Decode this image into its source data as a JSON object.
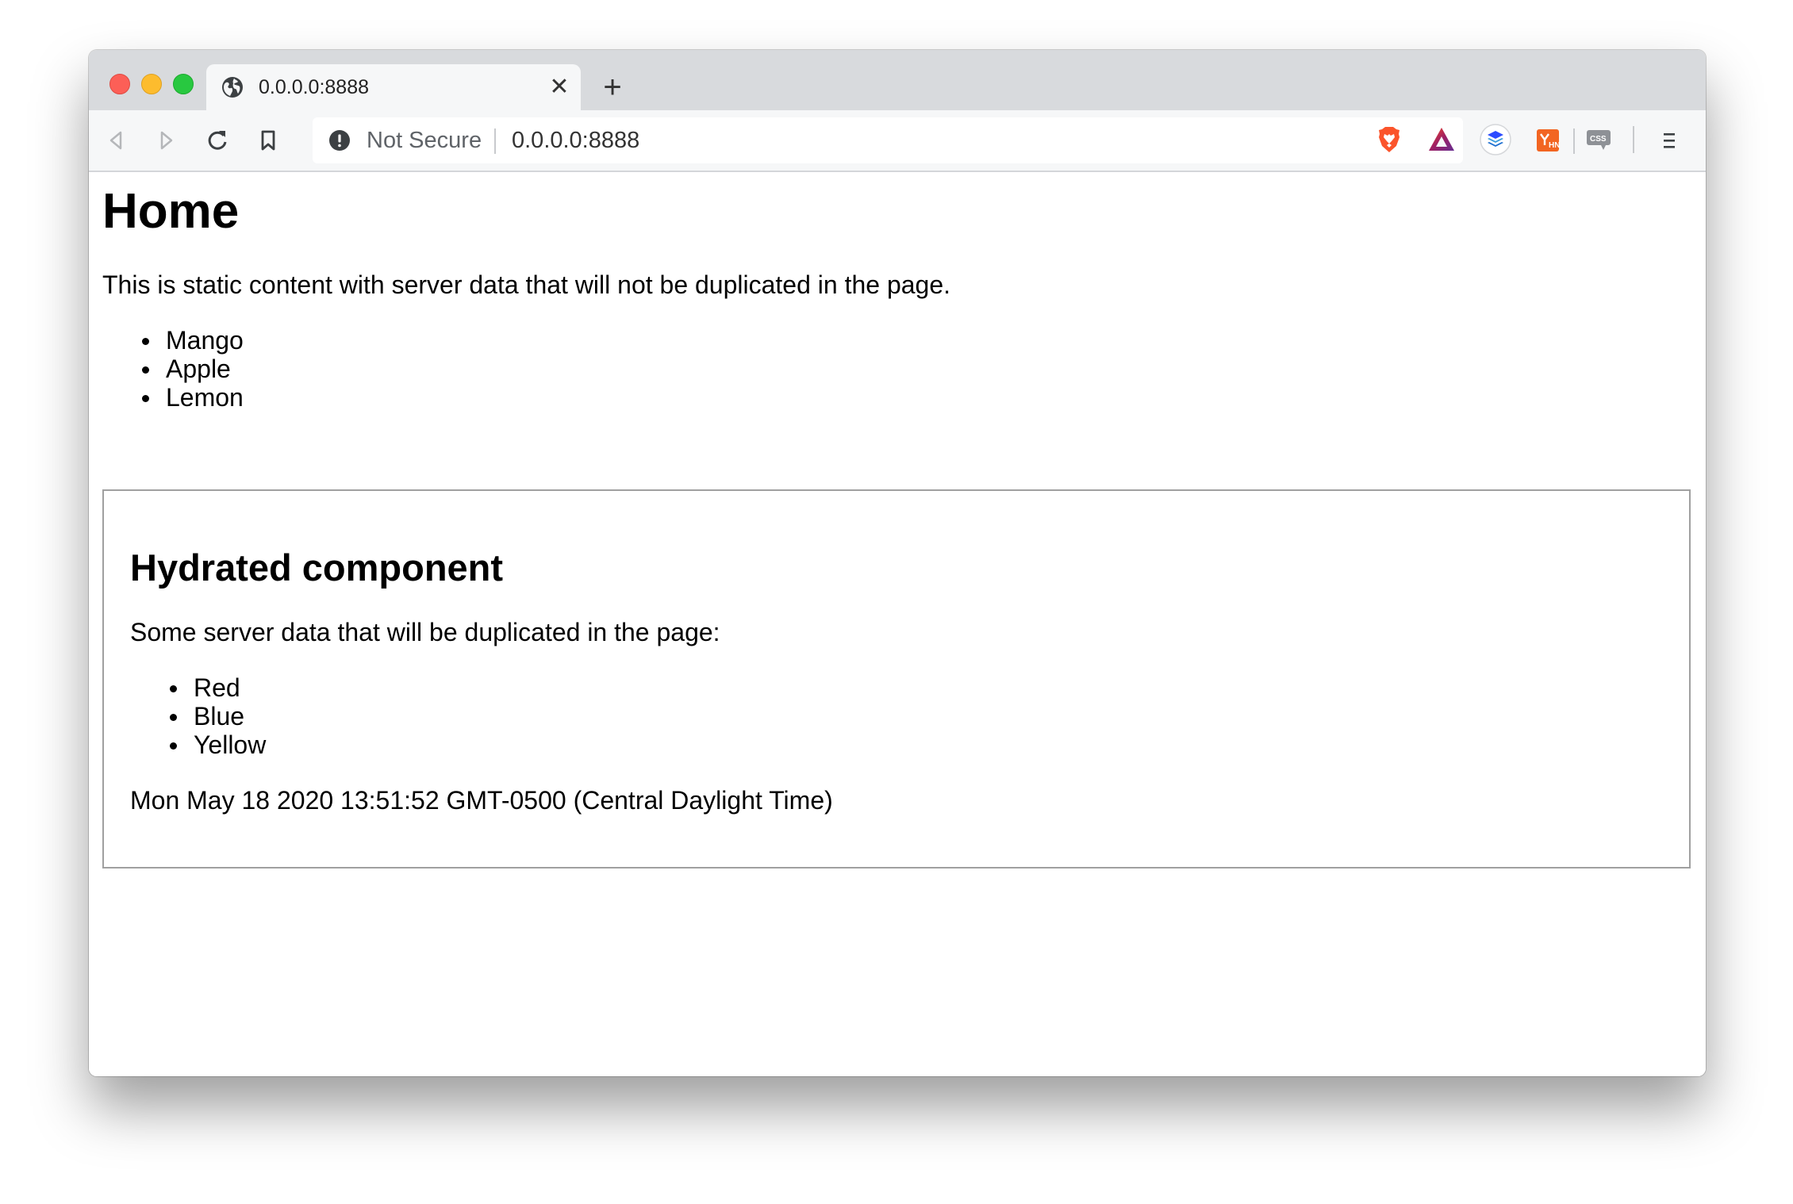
{
  "browser": {
    "tab": {
      "title": "0.0.0.0:8888"
    },
    "toolbar": {
      "security_label": "Not Secure",
      "url": "0.0.0.0:8888"
    },
    "extensions": [
      "brave-shield-icon",
      "brave-rewards-icon",
      "buffer-icon",
      "hacker-news-icon",
      "css-viewer-icon"
    ]
  },
  "page": {
    "title": "Home",
    "intro": "This is static content with server data that will not be duplicated in the page.",
    "fruits": [
      "Mango",
      "Apple",
      "Lemon"
    ],
    "hydrated": {
      "title": "Hydrated component",
      "text": "Some server data that will be duplicated in the page:",
      "colors": [
        "Red",
        "Blue",
        "Yellow"
      ],
      "timestamp": "Mon May 18 2020 13:51:52 GMT-0500 (Central Daylight Time)"
    }
  }
}
